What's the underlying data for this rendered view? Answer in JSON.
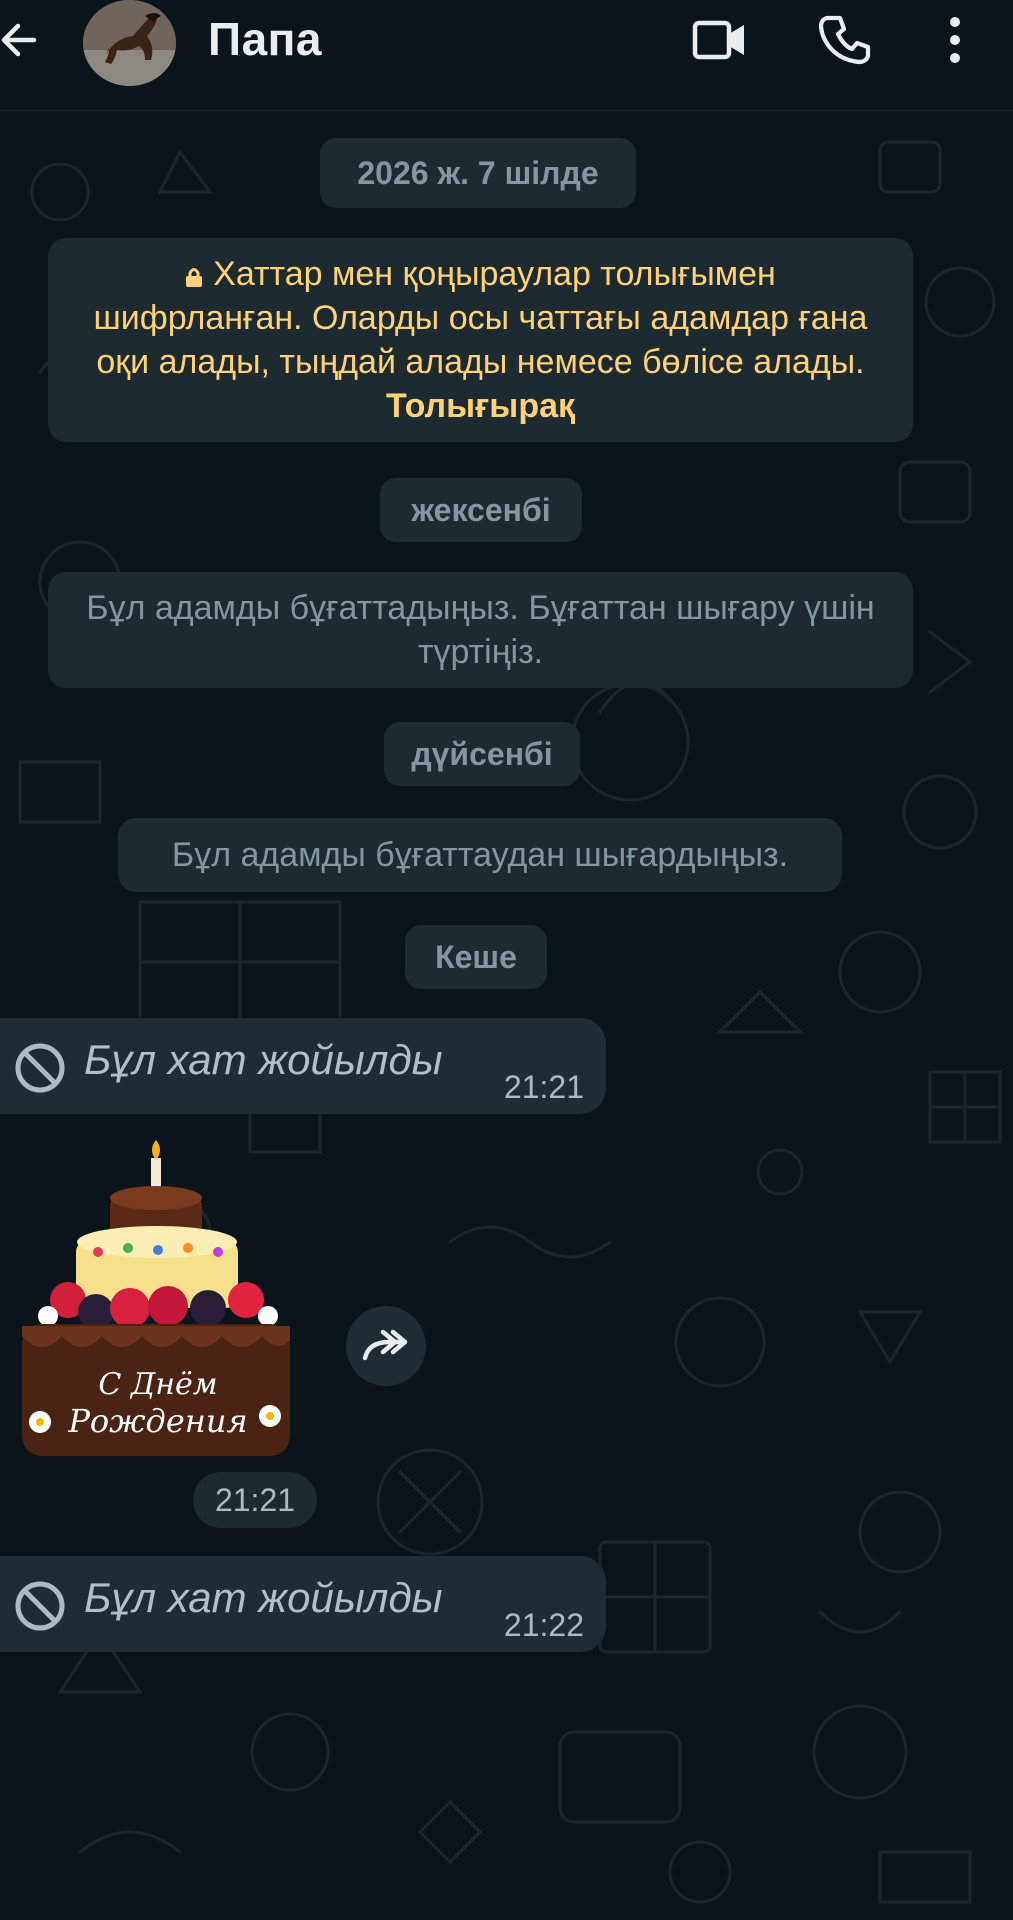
{
  "header": {
    "contact_name": "Папа",
    "icons": [
      "back-arrow-icon",
      "video-call-icon",
      "voice-call-icon",
      "more-options-icon"
    ]
  },
  "chat": {
    "date_pill_1": "2026 ж. 7 шілде",
    "encryption": {
      "text": "Хаттар мен қоңыраулар толығымен шифрланған. Оларды осы чаттағы адамдар ғана оқи алады, тыңдай алады немесе бөлісе алады.",
      "link": "Толығырақ"
    },
    "date_pill_2": "жексенбі",
    "blocked_notice": "Бұл адамды бұғаттадыңыз. Бұғаттан шығару үшін түртіңіз.",
    "date_pill_3": "дүйсенбі",
    "unblocked_notice": "Бұл адамды бұғаттаудан шығардыңыз.",
    "date_pill_4": "Кеше",
    "messages": [
      {
        "type": "deleted",
        "text": "Бұл хат жойылды",
        "time": "21:21"
      },
      {
        "type": "sticker",
        "sticker_text_line1": "С Днём",
        "sticker_text_line2": "Рождения",
        "time": "21:21"
      },
      {
        "type": "deleted",
        "text": "Бұл хат жойылды",
        "time": "21:22"
      }
    ]
  },
  "colors": {
    "background": "#0b141a",
    "bubble": "#202c33",
    "system_pill": "#1d2a30",
    "encryption_text": "#ffd279"
  }
}
